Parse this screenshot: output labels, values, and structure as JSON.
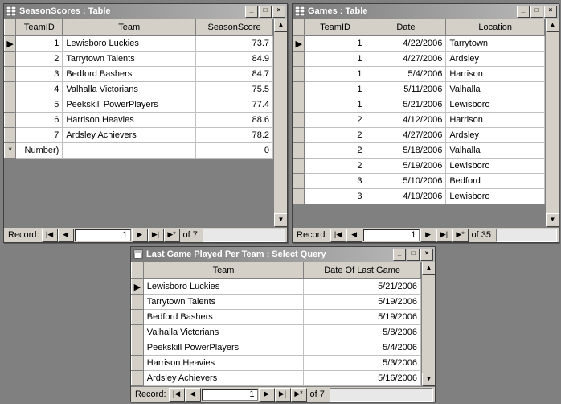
{
  "windows": {
    "seasonScores": {
      "title": "SeasonScores : Table",
      "columns": [
        "TeamID",
        "Team",
        "SeasonScore"
      ],
      "rows": [
        {
          "sel": "▶",
          "TeamID": "1",
          "Team": "Lewisboro Luckies",
          "SeasonScore": "73.7"
        },
        {
          "sel": "",
          "TeamID": "2",
          "Team": "Tarrytown Talents",
          "SeasonScore": "84.9"
        },
        {
          "sel": "",
          "TeamID": "3",
          "Team": "Bedford Bashers",
          "SeasonScore": "84.7"
        },
        {
          "sel": "",
          "TeamID": "4",
          "Team": "Valhalla Victorians",
          "SeasonScore": "75.5"
        },
        {
          "sel": "",
          "TeamID": "5",
          "Team": "Peekskill PowerPlayers",
          "SeasonScore": "77.4"
        },
        {
          "sel": "",
          "TeamID": "6",
          "Team": "Harrison Heavies",
          "SeasonScore": "88.6"
        },
        {
          "sel": "",
          "TeamID": "7",
          "Team": "Ardsley Achievers",
          "SeasonScore": "78.2"
        },
        {
          "sel": "*",
          "TeamID": "Number)",
          "Team": "",
          "SeasonScore": "0"
        }
      ],
      "nav": {
        "label": "Record:",
        "current": "1",
        "total": "of  7"
      }
    },
    "games": {
      "title": "Games : Table",
      "columns": [
        "TeamID",
        "Date",
        "Location"
      ],
      "rows": [
        {
          "sel": "▶",
          "TeamID": "1",
          "Date": "4/22/2006",
          "Location": "Tarrytown"
        },
        {
          "sel": "",
          "TeamID": "1",
          "Date": "4/27/2006",
          "Location": "Ardsley"
        },
        {
          "sel": "",
          "TeamID": "1",
          "Date": "5/4/2006",
          "Location": "Harrison"
        },
        {
          "sel": "",
          "TeamID": "1",
          "Date": "5/11/2006",
          "Location": "Valhalla"
        },
        {
          "sel": "",
          "TeamID": "1",
          "Date": "5/21/2006",
          "Location": "Lewisboro"
        },
        {
          "sel": "",
          "TeamID": "2",
          "Date": "4/12/2006",
          "Location": "Harrison"
        },
        {
          "sel": "",
          "TeamID": "2",
          "Date": "4/27/2006",
          "Location": "Ardsley"
        },
        {
          "sel": "",
          "TeamID": "2",
          "Date": "5/18/2006",
          "Location": "Valhalla"
        },
        {
          "sel": "",
          "TeamID": "2",
          "Date": "5/19/2006",
          "Location": "Lewisboro"
        },
        {
          "sel": "",
          "TeamID": "3",
          "Date": "5/10/2006",
          "Location": "Bedford"
        },
        {
          "sel": "",
          "TeamID": "3",
          "Date": "4/19/2006",
          "Location": "Lewisboro"
        }
      ],
      "nav": {
        "label": "Record:",
        "current": "1",
        "total": "of  35"
      }
    },
    "lastGame": {
      "title": "Last Game Played Per Team : Select Query",
      "columns": [
        "Team",
        "Date Of Last Game"
      ],
      "rows": [
        {
          "sel": "▶",
          "Team": "Lewisboro Luckies",
          "Date": "5/21/2006"
        },
        {
          "sel": "",
          "Team": "Tarrytown Talents",
          "Date": "5/19/2006"
        },
        {
          "sel": "",
          "Team": "Bedford Bashers",
          "Date": "5/19/2006"
        },
        {
          "sel": "",
          "Team": "Valhalla Victorians",
          "Date": "5/8/2006"
        },
        {
          "sel": "",
          "Team": "Peekskill PowerPlayers",
          "Date": "5/4/2006"
        },
        {
          "sel": "",
          "Team": "Harrison Heavies",
          "Date": "5/3/2006"
        },
        {
          "sel": "",
          "Team": "Ardsley Achievers",
          "Date": "5/16/2006"
        }
      ],
      "nav": {
        "label": "Record:",
        "current": "1",
        "total": "of  7"
      }
    }
  },
  "titleButtons": {
    "min": "_",
    "max": "□",
    "close": "×"
  },
  "navButtons": {
    "first": "|◀",
    "prev": "◀",
    "next": "▶",
    "last": "▶|",
    "new": "▶*"
  }
}
